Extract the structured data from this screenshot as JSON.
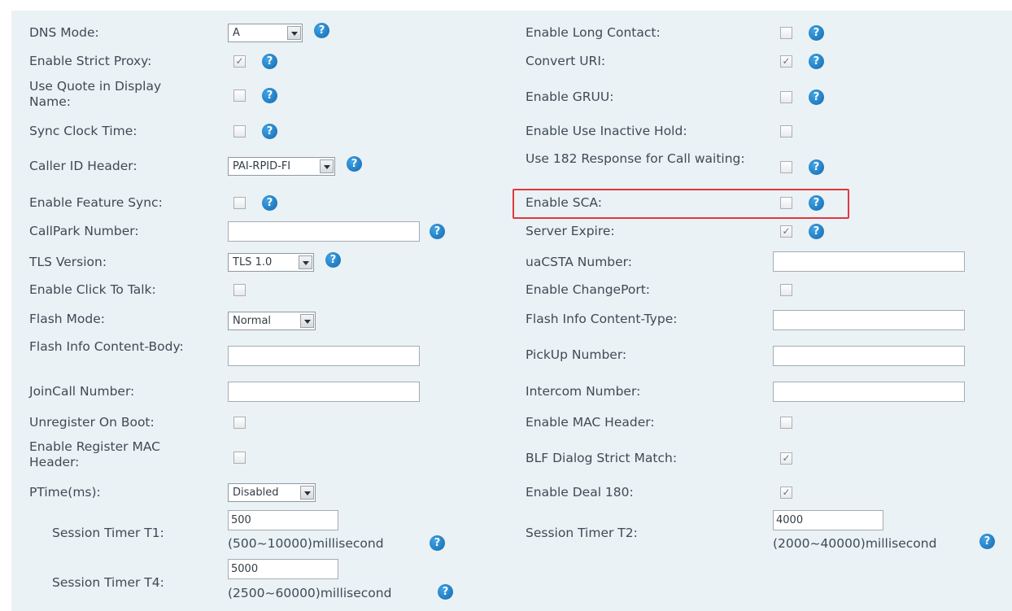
{
  "left": {
    "dns_mode": {
      "label": "DNS Mode:",
      "value": "A"
    },
    "strict_proxy": {
      "label": "Enable Strict Proxy:",
      "checked": true
    },
    "quote_display": {
      "label": "Use Quote in Display Name:",
      "checked": false
    },
    "sync_clock": {
      "label": "Sync Clock Time:",
      "checked": false
    },
    "caller_id": {
      "label": "Caller ID Header:",
      "value": "PAI-RPID-FI"
    },
    "feature_sync": {
      "label": "Enable Feature Sync:",
      "checked": false
    },
    "callpark": {
      "label": "CallPark Number:",
      "value": ""
    },
    "tls_version": {
      "label": "TLS Version:",
      "value": "TLS 1.0"
    },
    "click_to_talk": {
      "label": "Enable Click To Talk:",
      "checked": false
    },
    "flash_mode": {
      "label": "Flash Mode:",
      "value": "Normal"
    },
    "flash_body": {
      "label": "Flash Info Content-Body:",
      "value": ""
    },
    "joincall": {
      "label": "JoinCall Number:",
      "value": ""
    },
    "unregister_boot": {
      "label": "Unregister On Boot:",
      "checked": false
    },
    "register_mac": {
      "label": "Enable Register MAC Header:",
      "checked": false
    },
    "ptime": {
      "label": "PTime(ms):",
      "value": "Disabled"
    },
    "timer_t1": {
      "label": "Session Timer T1:",
      "value": "500",
      "hint": "(500~10000)millisecond"
    },
    "timer_t4": {
      "label": "Session Timer T4:",
      "value": "5000",
      "hint": "(2500~60000)millisecond"
    }
  },
  "right": {
    "long_contact": {
      "label": "Enable Long Contact:",
      "checked": false
    },
    "convert_uri": {
      "label": "Convert URI:",
      "checked": true
    },
    "gruu": {
      "label": "Enable GRUU:",
      "checked": false
    },
    "inactive_hold": {
      "label": "Enable Use Inactive Hold:",
      "checked": false
    },
    "response_182": {
      "label": "Use 182 Response for Call waiting:",
      "checked": false
    },
    "sca": {
      "label": "Enable SCA:",
      "checked": false
    },
    "server_expire": {
      "label": "Server Expire:",
      "checked": true
    },
    "uacsta": {
      "label": "uaCSTA Number:",
      "value": ""
    },
    "changeport": {
      "label": "Enable ChangePort:",
      "checked": false
    },
    "flash_type": {
      "label": "Flash Info Content-Type:",
      "value": ""
    },
    "pickup": {
      "label": "PickUp Number:",
      "value": ""
    },
    "intercom": {
      "label": "Intercom Number:",
      "value": ""
    },
    "mac_header": {
      "label": "Enable MAC Header:",
      "checked": false
    },
    "blf_strict": {
      "label": "BLF Dialog Strict Match:",
      "checked": true
    },
    "deal_180": {
      "label": "Enable Deal 180:",
      "checked": true
    },
    "timer_t2": {
      "label": "Session Timer T2:",
      "value": "4000",
      "hint": "(2000~40000)millisecond"
    }
  },
  "icons": {
    "help": "help-icon",
    "check_mark": "✓",
    "help_glyph": "?"
  },
  "colors": {
    "panel_bg": "#eaf2f5",
    "help_blue": "#1f7bc4",
    "highlight": "#e0383e"
  }
}
